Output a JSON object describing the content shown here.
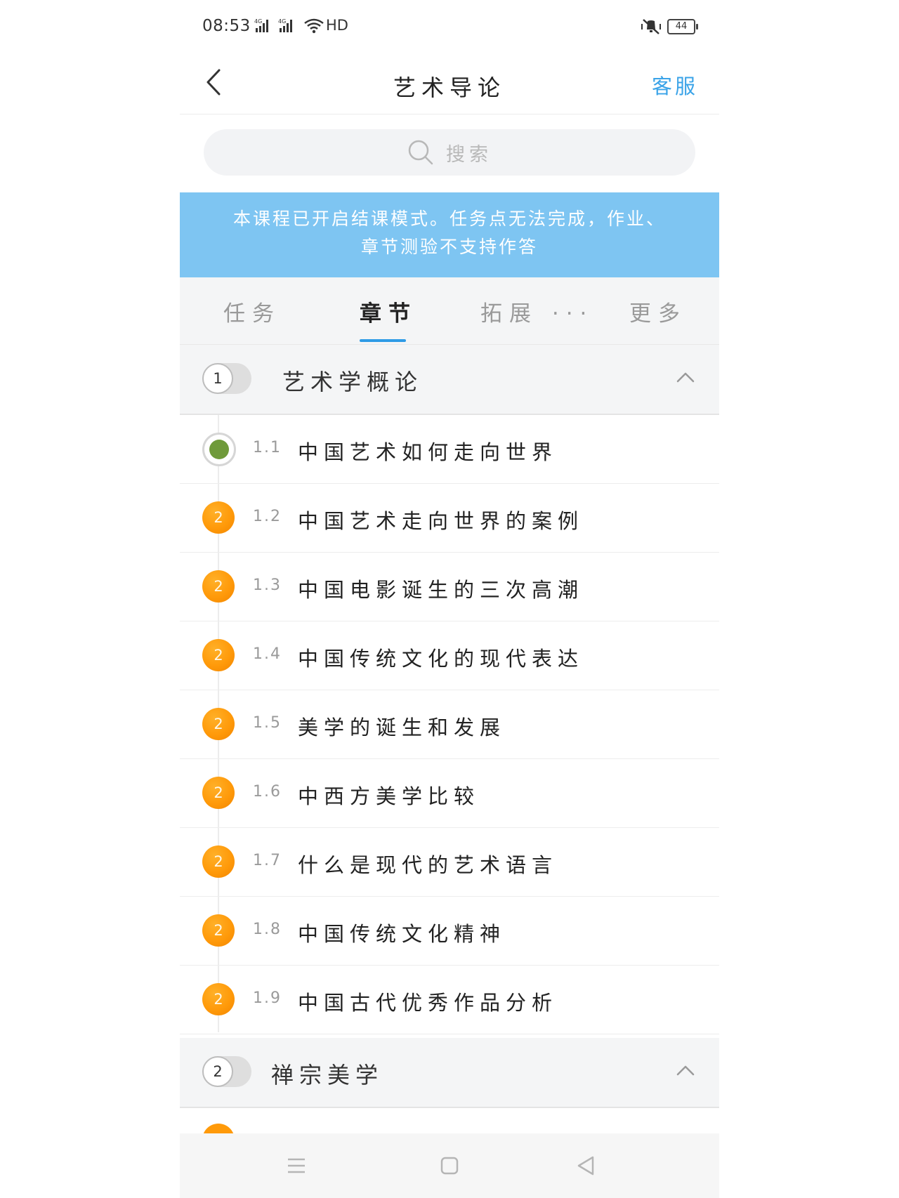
{
  "status_bar": {
    "time": "08:53",
    "network_1": "4G",
    "network_2": "4G",
    "wifi_label": "HD",
    "battery": "44"
  },
  "nav": {
    "title": "艺术导论",
    "service": "客服"
  },
  "search": {
    "placeholder": "搜索"
  },
  "notice": {
    "line1": "本课程已开启结课模式。任务点无法完成，作业、",
    "line2": "章节测验不支持作答"
  },
  "tabs": [
    {
      "label": "任务"
    },
    {
      "label": "章节"
    },
    {
      "label": "拓展 ···"
    },
    {
      "label": "更多"
    }
  ],
  "chapters": [
    {
      "index": "1",
      "title": "艺术学概论",
      "lessons": [
        {
          "num": "1.1",
          "title": "中国艺术如何走向世界",
          "badge": ""
        },
        {
          "num": "1.2",
          "title": "中国艺术走向世界的案例",
          "badge": "2"
        },
        {
          "num": "1.3",
          "title": "中国电影诞生的三次高潮",
          "badge": "2"
        },
        {
          "num": "1.4",
          "title": "中国传统文化的现代表达",
          "badge": "2"
        },
        {
          "num": "1.5",
          "title": "美学的诞生和发展",
          "badge": "2"
        },
        {
          "num": "1.6",
          "title": "中西方美学比较",
          "badge": "2"
        },
        {
          "num": "1.7",
          "title": "什么是现代的艺术语言",
          "badge": "2"
        },
        {
          "num": "1.8",
          "title": "中国传统文化精神",
          "badge": "2"
        },
        {
          "num": "1.9",
          "title": "中国古代优秀作品分析",
          "badge": "2"
        }
      ]
    },
    {
      "index": "2",
      "title": "禅宗美学"
    }
  ],
  "colors": {
    "accent": "#3aa3e8",
    "banner": "#7ec5f2",
    "badge": "#ff9a0a",
    "done": "#6f9a3a"
  }
}
